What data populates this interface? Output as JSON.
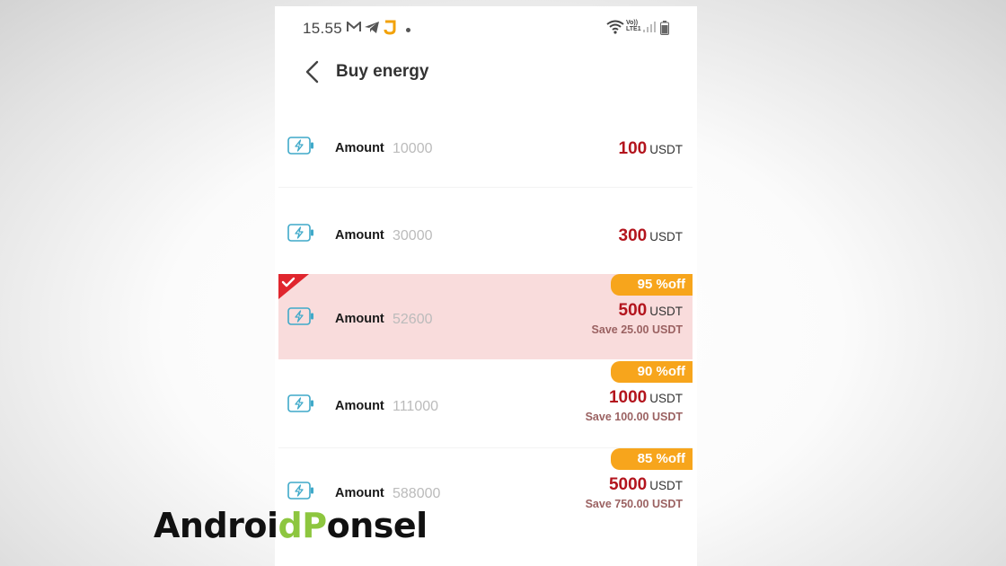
{
  "status_bar": {
    "time": "15.55",
    "icons": [
      "mail-icon",
      "telegram-icon",
      "j-app-icon",
      "dot-icon",
      "wifi-icon",
      "volte-icon",
      "signal-icon",
      "battery-icon"
    ],
    "volte_line1": "Vo))",
    "volte_line2": "LTE1"
  },
  "header": {
    "back_icon": "chevron-left-icon",
    "title": "Buy energy"
  },
  "packages": [
    {
      "label": "Amount",
      "amount": "10000",
      "price": "100",
      "unit": "USDT",
      "selected": false
    },
    {
      "label": "Amount",
      "amount": "30000",
      "price": "300",
      "unit": "USDT",
      "selected": false
    },
    {
      "label": "Amount",
      "amount": "52600",
      "price": "500",
      "unit": "USDT",
      "discount": "95 %off",
      "save": "Save 25.00 USDT",
      "selected": true
    },
    {
      "label": "Amount",
      "amount": "111000",
      "price": "1000",
      "unit": "USDT",
      "discount": "90 %off",
      "save": "Save 100.00 USDT",
      "selected": false
    },
    {
      "label": "Amount",
      "amount": "588000",
      "price": "5000",
      "unit": "USDT",
      "discount": "85 %off",
      "save": "Save 750.00 USDT",
      "selected": false
    }
  ],
  "watermark": {
    "part1": "Androi",
    "part2": "dP",
    "part3": "onsel"
  },
  "colors": {
    "price": "#b3141d",
    "discount_badge": "#f7a51c",
    "selected_row": "#f9dcdc",
    "selected_corner": "#e0262e",
    "energy_icon": "#3fa9c9"
  }
}
